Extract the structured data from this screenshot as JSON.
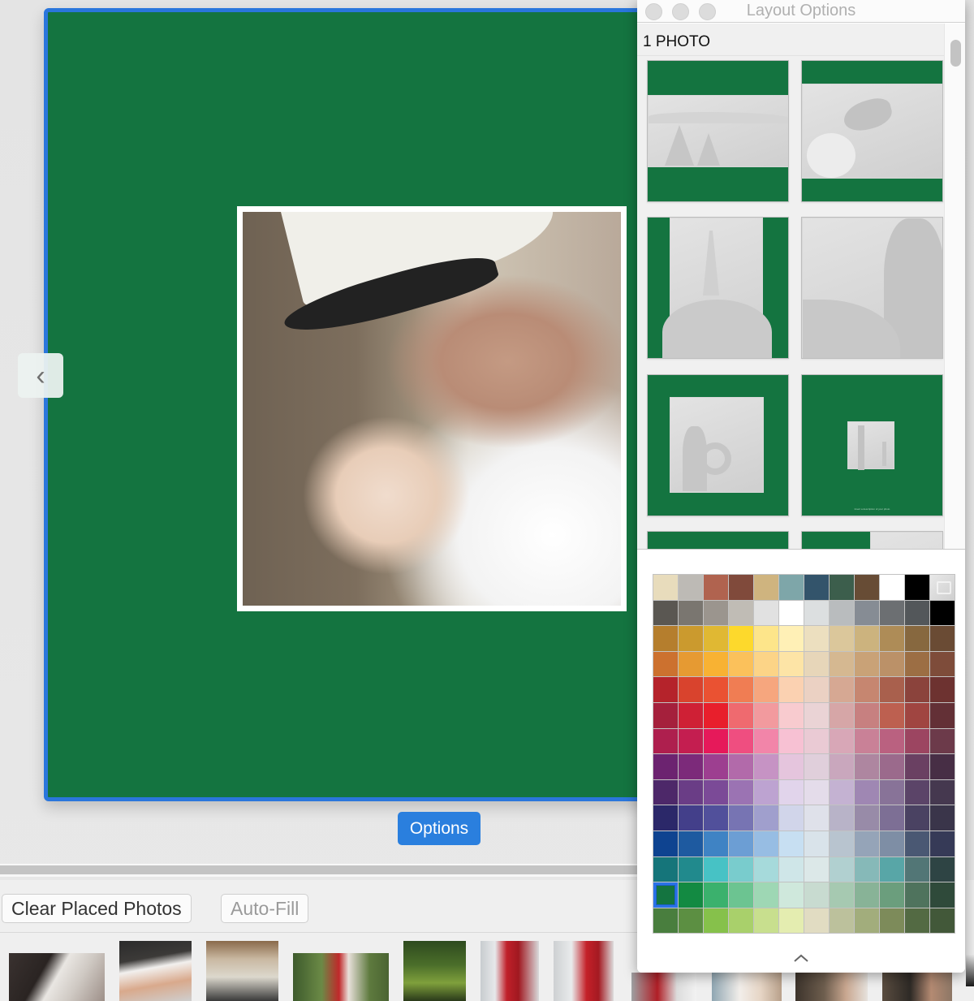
{
  "page": {
    "background_color": "#147440",
    "selection_border_color": "#2a76dc"
  },
  "navigation": {
    "prev_icon": "chevron-left-icon",
    "prev_glyph": "‹"
  },
  "options_button": {
    "label": "Options",
    "color": "#2a7fde"
  },
  "strip": {
    "buttons": [
      {
        "label": "Clear Placed Photos",
        "enabled": true
      },
      {
        "label": "Auto-Fill",
        "enabled": false
      }
    ],
    "thumbnails": [
      "cat-on-keyboard",
      "cat-with-hand",
      "man-at-desk",
      "woman-with-dog-by-stream",
      "forest-trees",
      "woman-in-red-cape",
      "woman-in-red-cape-2",
      "woman-on-porch",
      "man-with-lamb",
      "man-smiling",
      "man-with-lamb-close"
    ]
  },
  "layout_panel": {
    "title": "Layout Options",
    "section_heading": "1 PHOTO",
    "layouts": [
      {
        "name": "horizontal-band-landscape",
        "placeholder": "mountains-trees"
      },
      {
        "name": "top-heavy-landscape",
        "placeholder": "butterfly"
      },
      {
        "name": "vertical-band-portrait",
        "placeholder": "eiffel-tower"
      },
      {
        "name": "full-bleed",
        "placeholder": "man-silhouette"
      },
      {
        "name": "centered-medium",
        "placeholder": "father-child-swing"
      },
      {
        "name": "centered-small-with-caption",
        "placeholder": "golden-gate-bridge",
        "caption": "Insert a description of your photo"
      }
    ],
    "palette": {
      "selected_color": "#147440",
      "rows": [
        [
          "#e8dcbc",
          "#bdbab5",
          "#b0634f",
          "#804a3b",
          "#cfb47f",
          "#7ea6a9",
          "#33546b",
          "#3c5e4c",
          "#674c35",
          "#ffffff",
          "#000000",
          "custom"
        ],
        [
          "#5a5752",
          "#7a7670",
          "#9b958e",
          "#c0bcb5",
          "#e1e1e1",
          "#ffffff",
          "#dcdfe0",
          "#b9bcbe",
          "#868c94",
          "#6c6f72",
          "#53575a",
          "#000000"
        ],
        [
          "#b57e2d",
          "#cb9a2e",
          "#e0b833",
          "#fdd92c",
          "#fde58a",
          "#fff0b6",
          "#ecdfbf",
          "#dbc79b",
          "#ccb37e",
          "#ae8c57",
          "#87683f",
          "#6a4b34"
        ],
        [
          "#cc712f",
          "#e69a32",
          "#f8b233",
          "#fbc15b",
          "#fcd487",
          "#fde4a6",
          "#e7d6b9",
          "#d5b891",
          "#c9a277",
          "#bb9168",
          "#9c6e44",
          "#7e4c3a"
        ],
        [
          "#b5232b",
          "#d9432d",
          "#ea5232",
          "#f07d53",
          "#f6a67e",
          "#fbd1b1",
          "#ebd1c3",
          "#d6a893",
          "#c68670",
          "#a9604d",
          "#8b433c",
          "#6d3230"
        ],
        [
          "#a5203c",
          "#cf2035",
          "#e81f2c",
          "#ef6a6f",
          "#f29a9e",
          "#f8cbcf",
          "#ead3d5",
          "#d6a6a7",
          "#c78080",
          "#bd6050",
          "#a04541",
          "#633036"
        ],
        [
          "#ae1f4e",
          "#c41e50",
          "#e6195a",
          "#ef4e80",
          "#f285a9",
          "#f7c1d3",
          "#eacad4",
          "#d8a7b7",
          "#c98197",
          "#ba6180",
          "#9c4561",
          "#6c3a4a"
        ],
        [
          "#6c2370",
          "#7c2a7a",
          "#9d3f90",
          "#b26aaa",
          "#c693c4",
          "#e5c5dd",
          "#e0cfdb",
          "#c9a7bd",
          "#ae86a0",
          "#9b6a8c",
          "#6a4062",
          "#472e45"
        ],
        [
          "#4d2869",
          "#6a3d86",
          "#7b4a97",
          "#9b73b3",
          "#bda3d1",
          "#e1d4eb",
          "#e4dcea",
          "#c4b2d2",
          "#9f87b3",
          "#887398",
          "#5b4468",
          "#45384f"
        ],
        [
          "#2b2869",
          "#433f8a",
          "#51509b",
          "#7774b3",
          "#a09fcd",
          "#d1d5ea",
          "#dfe1ea",
          "#b8b3c8",
          "#988ba8",
          "#7d6f95",
          "#4a4262",
          "#3a354a"
        ],
        [
          "#0e4390",
          "#1e5aa0",
          "#3f83c4",
          "#6c9ed4",
          "#97bde3",
          "#c7dff2",
          "#d9e3ea",
          "#b8c4cf",
          "#95a4b8",
          "#7e8ea5",
          "#4a5873",
          "#363a57"
        ],
        [
          "#15757a",
          "#218a8d",
          "#47c2c5",
          "#79cccd",
          "#a6dadb",
          "#cfe6e8",
          "#dce8e8",
          "#b1d0d0",
          "#86b9b8",
          "#58a6a7",
          "#527676",
          "#2e4444"
        ],
        [
          "#147440",
          "#138a42",
          "#3bb16d",
          "#6cc491",
          "#9ed7b4",
          "#cfe8dc",
          "#c8dbd0",
          "#a6c9b1",
          "#88b397",
          "#6b9e7d",
          "#4f735d",
          "#2f4a3a"
        ],
        [
          "#497e3e",
          "#5c8f42",
          "#86c14b",
          "#a9d06b",
          "#c8df8e",
          "#e4edb0",
          "#e1dcc2",
          "#bcc19c",
          "#a2ad7c",
          "#7d8b5a",
          "#536a43",
          "#425839"
        ]
      ]
    },
    "collapse_icon": "chevron-up-icon"
  }
}
